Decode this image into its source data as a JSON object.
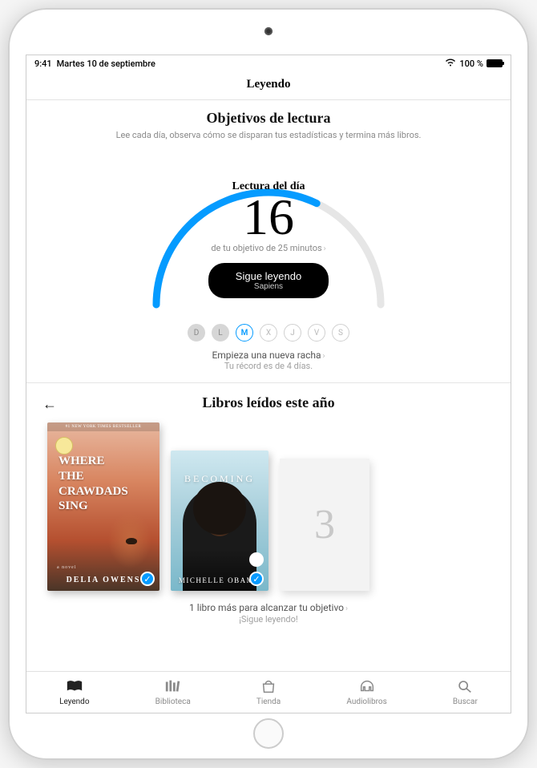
{
  "status": {
    "time": "9:41",
    "date": "Martes 10 de septiembre",
    "battery_pct": "100 %"
  },
  "nav": {
    "title": "Leyendo"
  },
  "goals": {
    "title": "Objetivos de lectura",
    "subtitle": "Lee cada día, observa cómo se disparan tus estadísticas y termina más libros.",
    "today_label": "Lectura del día",
    "today_minutes": "16",
    "today_goal_text": "de tu objetivo de 25 minutos",
    "progress_fraction": 0.64,
    "cta_label": "Sigue leyendo",
    "cta_book": "Sapiens",
    "days": [
      {
        "letter": "D",
        "state": "done"
      },
      {
        "letter": "L",
        "state": "done"
      },
      {
        "letter": "M",
        "state": "active"
      },
      {
        "letter": "X",
        "state": "future"
      },
      {
        "letter": "J",
        "state": "future"
      },
      {
        "letter": "V",
        "state": "future"
      },
      {
        "letter": "S",
        "state": "future"
      }
    ],
    "streak_label": "Empieza una nueva racha",
    "streak_sub": "Tu récord es de 4 días."
  },
  "books": {
    "header": "Libros leídos este año",
    "items": [
      {
        "title": "Where the Crawdads Sing",
        "author": "DELIA OWENS",
        "bestseller": "#1 NEW YORK TIMES BESTSELLER",
        "anovel": "a novel",
        "checked": true
      },
      {
        "title": "BECOMING",
        "author": "MICHELLE OBAMA",
        "checked": true
      }
    ],
    "placeholder_number": "3",
    "goal_progress": "1 libro más para alcanzar tu objetivo",
    "goal_cheer": "¡Sigue leyendo!"
  },
  "tabs": {
    "items": [
      {
        "key": "leyendo",
        "label": "Leyendo",
        "active": true
      },
      {
        "key": "biblioteca",
        "label": "Biblioteca",
        "active": false
      },
      {
        "key": "tienda",
        "label": "Tienda",
        "active": false
      },
      {
        "key": "audiolibros",
        "label": "Audiolibros",
        "active": false
      },
      {
        "key": "buscar",
        "label": "Buscar",
        "active": false
      }
    ]
  },
  "colors": {
    "accent": "#059bff"
  }
}
